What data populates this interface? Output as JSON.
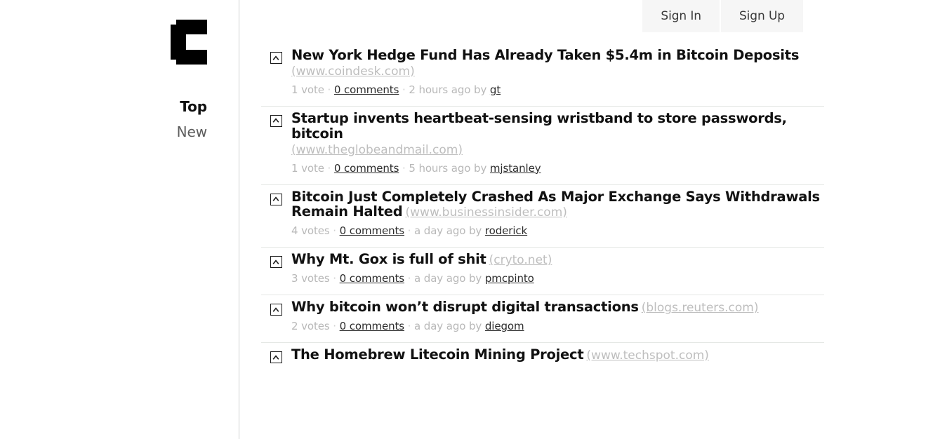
{
  "site": {
    "logo_icon": "blocky-c-logo"
  },
  "sidebar": {
    "nav": [
      {
        "label": "Top",
        "active": true
      },
      {
        "label": "New",
        "active": false
      }
    ]
  },
  "header": {
    "sign_in_label": "Sign In",
    "sign_up_label": "Sign Up"
  },
  "stories": [
    {
      "title": "New York Hedge Fund Has Already Taken $5.4m in Bitcoin Deposits",
      "domain": "(www.coindesk.com)",
      "domain_stacked": true,
      "votes": "1 vote",
      "comments": "0 comments",
      "age": "2 hours ago by",
      "author": "gt",
      "upvote_icon": "upvote-caret-icon"
    },
    {
      "title": "Startup invents heartbeat-sensing wristband to store passwords, bitcoin",
      "domain": "(www.theglobeandmail.com)",
      "domain_stacked": true,
      "votes": "1 vote",
      "comments": "0 comments",
      "age": "5 hours ago by",
      "author": "mjstanley",
      "upvote_icon": "upvote-caret-icon"
    },
    {
      "title": "Bitcoin Just Completely Crashed As Major Exchange Says Withdrawals Remain Halted",
      "domain": "(www.businessinsider.com)",
      "domain_stacked": false,
      "votes": "4 votes",
      "comments": "0 comments",
      "age": "a day ago by",
      "author": "roderick",
      "upvote_icon": "upvote-caret-icon"
    },
    {
      "title": "Why Mt. Gox is full of shit",
      "domain": "(cryto.net)",
      "domain_stacked": false,
      "votes": "3 votes",
      "comments": "0 comments",
      "age": "a day ago by",
      "author": "pmcpinto",
      "upvote_icon": "upvote-caret-icon"
    },
    {
      "title": "Why bitcoin won’t disrupt digital transactions",
      "domain": "(blogs.reuters.com)",
      "domain_stacked": false,
      "votes": "2 votes",
      "comments": "0 comments",
      "age": "a day ago by",
      "author": "diegom",
      "upvote_icon": "upvote-caret-icon"
    },
    {
      "title": "The Homebrew Litecoin Mining Project",
      "domain": "(www.techspot.com)",
      "domain_stacked": false,
      "votes": "",
      "comments": "",
      "age": "",
      "author": "",
      "upvote_icon": "upvote-caret-icon"
    }
  ],
  "colors": {
    "text": "#111111",
    "muted": "#b8b8b8",
    "domain": "#bebebe",
    "divider": "#e4e7e4",
    "sidebar_border": "#cfd2d2",
    "button_bg": "#f6f6f6"
  }
}
